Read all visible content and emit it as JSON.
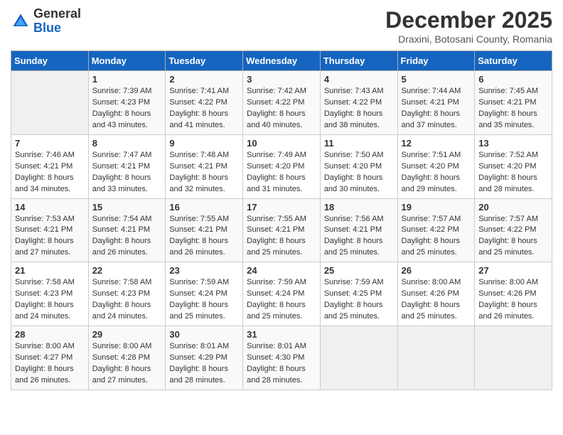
{
  "logo": {
    "general": "General",
    "blue": "Blue"
  },
  "title": "December 2025",
  "subtitle": "Draxini, Botosani County, Romania",
  "days_header": [
    "Sunday",
    "Monday",
    "Tuesday",
    "Wednesday",
    "Thursday",
    "Friday",
    "Saturday"
  ],
  "weeks": [
    [
      {
        "day": "",
        "empty": true
      },
      {
        "day": "1",
        "sunrise": "7:39 AM",
        "sunset": "4:23 PM",
        "daylight": "8 hours and 43 minutes."
      },
      {
        "day": "2",
        "sunrise": "7:41 AM",
        "sunset": "4:22 PM",
        "daylight": "8 hours and 41 minutes."
      },
      {
        "day": "3",
        "sunrise": "7:42 AM",
        "sunset": "4:22 PM",
        "daylight": "8 hours and 40 minutes."
      },
      {
        "day": "4",
        "sunrise": "7:43 AM",
        "sunset": "4:22 PM",
        "daylight": "8 hours and 38 minutes."
      },
      {
        "day": "5",
        "sunrise": "7:44 AM",
        "sunset": "4:21 PM",
        "daylight": "8 hours and 37 minutes."
      },
      {
        "day": "6",
        "sunrise": "7:45 AM",
        "sunset": "4:21 PM",
        "daylight": "8 hours and 35 minutes."
      }
    ],
    [
      {
        "day": "7",
        "sunrise": "7:46 AM",
        "sunset": "4:21 PM",
        "daylight": "8 hours and 34 minutes."
      },
      {
        "day": "8",
        "sunrise": "7:47 AM",
        "sunset": "4:21 PM",
        "daylight": "8 hours and 33 minutes."
      },
      {
        "day": "9",
        "sunrise": "7:48 AM",
        "sunset": "4:21 PM",
        "daylight": "8 hours and 32 minutes."
      },
      {
        "day": "10",
        "sunrise": "7:49 AM",
        "sunset": "4:20 PM",
        "daylight": "8 hours and 31 minutes."
      },
      {
        "day": "11",
        "sunrise": "7:50 AM",
        "sunset": "4:20 PM",
        "daylight": "8 hours and 30 minutes."
      },
      {
        "day": "12",
        "sunrise": "7:51 AM",
        "sunset": "4:20 PM",
        "daylight": "8 hours and 29 minutes."
      },
      {
        "day": "13",
        "sunrise": "7:52 AM",
        "sunset": "4:20 PM",
        "daylight": "8 hours and 28 minutes."
      }
    ],
    [
      {
        "day": "14",
        "sunrise": "7:53 AM",
        "sunset": "4:21 PM",
        "daylight": "8 hours and 27 minutes."
      },
      {
        "day": "15",
        "sunrise": "7:54 AM",
        "sunset": "4:21 PM",
        "daylight": "8 hours and 26 minutes."
      },
      {
        "day": "16",
        "sunrise": "7:55 AM",
        "sunset": "4:21 PM",
        "daylight": "8 hours and 26 minutes."
      },
      {
        "day": "17",
        "sunrise": "7:55 AM",
        "sunset": "4:21 PM",
        "daylight": "8 hours and 25 minutes."
      },
      {
        "day": "18",
        "sunrise": "7:56 AM",
        "sunset": "4:21 PM",
        "daylight": "8 hours and 25 minutes."
      },
      {
        "day": "19",
        "sunrise": "7:57 AM",
        "sunset": "4:22 PM",
        "daylight": "8 hours and 25 minutes."
      },
      {
        "day": "20",
        "sunrise": "7:57 AM",
        "sunset": "4:22 PM",
        "daylight": "8 hours and 25 minutes."
      }
    ],
    [
      {
        "day": "21",
        "sunrise": "7:58 AM",
        "sunset": "4:23 PM",
        "daylight": "8 hours and 24 minutes."
      },
      {
        "day": "22",
        "sunrise": "7:58 AM",
        "sunset": "4:23 PM",
        "daylight": "8 hours and 24 minutes."
      },
      {
        "day": "23",
        "sunrise": "7:59 AM",
        "sunset": "4:24 PM",
        "daylight": "8 hours and 25 minutes."
      },
      {
        "day": "24",
        "sunrise": "7:59 AM",
        "sunset": "4:24 PM",
        "daylight": "8 hours and 25 minutes."
      },
      {
        "day": "25",
        "sunrise": "7:59 AM",
        "sunset": "4:25 PM",
        "daylight": "8 hours and 25 minutes."
      },
      {
        "day": "26",
        "sunrise": "8:00 AM",
        "sunset": "4:26 PM",
        "daylight": "8 hours and 25 minutes."
      },
      {
        "day": "27",
        "sunrise": "8:00 AM",
        "sunset": "4:26 PM",
        "daylight": "8 hours and 26 minutes."
      }
    ],
    [
      {
        "day": "28",
        "sunrise": "8:00 AM",
        "sunset": "4:27 PM",
        "daylight": "8 hours and 26 minutes."
      },
      {
        "day": "29",
        "sunrise": "8:00 AM",
        "sunset": "4:28 PM",
        "daylight": "8 hours and 27 minutes."
      },
      {
        "day": "30",
        "sunrise": "8:01 AM",
        "sunset": "4:29 PM",
        "daylight": "8 hours and 28 minutes."
      },
      {
        "day": "31",
        "sunrise": "8:01 AM",
        "sunset": "4:30 PM",
        "daylight": "8 hours and 28 minutes."
      },
      {
        "day": "",
        "empty": true
      },
      {
        "day": "",
        "empty": true
      },
      {
        "day": "",
        "empty": true
      }
    ]
  ],
  "labels": {
    "sunrise": "Sunrise:",
    "sunset": "Sunset:",
    "daylight": "Daylight:"
  }
}
